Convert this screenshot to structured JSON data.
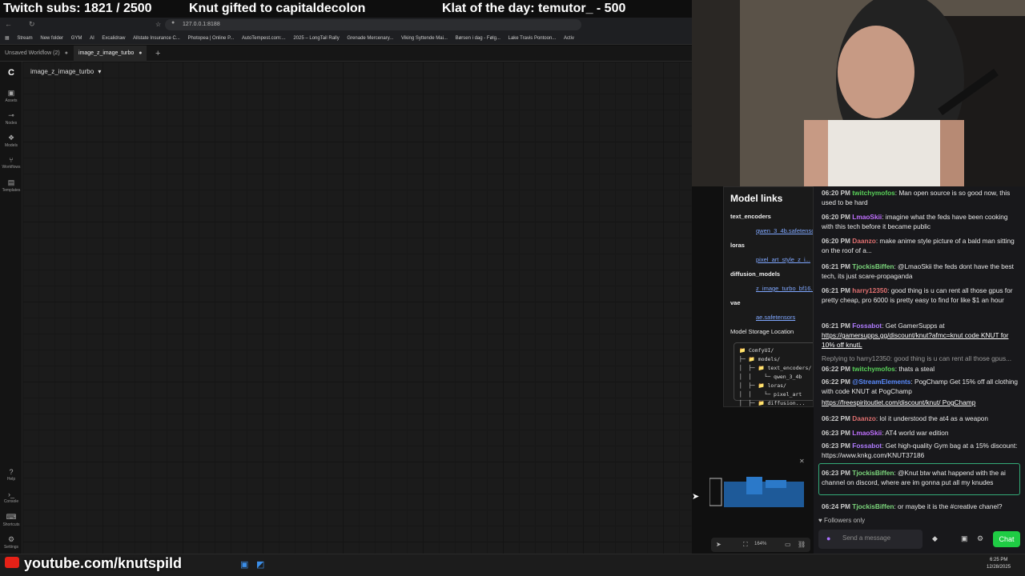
{
  "overlay": {
    "subs": "Twitch subs: 1821 / 2500",
    "gift": "Knut gifted to capitaldecolon",
    "klat": "Klat of the day: temutor_ - 500"
  },
  "browser": {
    "url": "127.0.0.1:8188",
    "bookmarks": [
      "Stream",
      "New folder",
      "GYM",
      "AI",
      "Excalidraw",
      "Allstate Insurance C...",
      "Photopea | Online P...",
      "AutoTempest.com:...",
      "2025 – LongTail Rally",
      "Grenade Mercenary...",
      "Viking Syttende Mai...",
      "Børsen i dag - Følg...",
      "Lake Travis Pontoon...",
      "Activ"
    ]
  },
  "tabs": [
    {
      "label": "Unsaved Workflow (2)"
    },
    {
      "label": "image_z_image_turbo"
    }
  ],
  "sidebar": {
    "top": [
      {
        "label": "Assets",
        "icon": "assets-icon"
      },
      {
        "label": "Nodes",
        "icon": "nodes-icon"
      },
      {
        "label": "Models",
        "icon": "models-icon"
      },
      {
        "label": "Workflows",
        "icon": "workflows-icon"
      },
      {
        "label": "Templates",
        "icon": "templates-icon"
      }
    ],
    "bottom": [
      {
        "label": "Help",
        "icon": "help-icon"
      },
      {
        "label": "Console",
        "icon": "console-icon"
      },
      {
        "label": "Shortcuts",
        "icon": "shortcuts-icon"
      },
      {
        "label": "Settings",
        "icon": "settings-icon"
      }
    ]
  },
  "workflow": {
    "name": "image_z_image_turbo"
  },
  "model_links": {
    "title": "Model links",
    "sections": [
      {
        "name": "text_encoders",
        "link": "qwen_3_4b.safetensors"
      },
      {
        "name": "loras",
        "link": "pixel_art_style_z_i..."
      },
      {
        "name": "diffusion_models",
        "link": "z_image_turbo_bf16..."
      },
      {
        "name": "vae",
        "link": "ae.safetensors"
      }
    ],
    "storage_title": "Model Storage Location",
    "tree": "📁 ComfyUI/\n├─ 📁 models/\n│  ├─ 📁 text_encoders/\n│  │    └─ qwen_3_4b\n│  ├─ 📁 loras/\n│  │    └─ pixel_art\n│  ├─ 📁 diffusion..."
  },
  "chat": {
    "messages": [
      {
        "time": "06:20 PM",
        "user": "twitchymofos",
        "color": "#5ad35a",
        "text": ": Man open source is so good now, this used to be hard"
      },
      {
        "time": "06:20 PM",
        "user": "LmaoSkii",
        "color": "#c070ff",
        "text": ": imagine what the feds have been cooking with this tech before it became public"
      },
      {
        "time": "06:20 PM",
        "user": "Daanzo",
        "color": "#e07070",
        "text": ": make anime style picture of a bald man sitting on the roof of a..."
      },
      {
        "time": "06:21 PM",
        "user": "TjockisBiffen",
        "color": "#7dd87d",
        "text": ": @LmaoSkii the feds dont have the best tech, its just scare-propaganda"
      },
      {
        "time": "06:21 PM",
        "user": "harry12350",
        "color": "#e07070",
        "text": ": good thing is u can rent all those gpus for pretty cheap, pro 6000 is pretty easy to find for like $1 an hour"
      },
      {
        "time": "06:21 PM",
        "user": "Fossabot",
        "color": "#b07cff",
        "text": ": Get GamerSupps at"
      },
      {
        "time": "",
        "user": "",
        "color": "#fff",
        "text": "https://gamersupps.gg/discount/knut?afmc=knut code KNUT for 10% off knutL"
      },
      {
        "time": "",
        "user": "",
        "color": "#999",
        "text": "Replying to harry12350: good thing is u can rent all those gpus..."
      },
      {
        "time": "06:22 PM",
        "user": "twitchymofos",
        "color": "#5ad35a",
        "text": ": thats a steal"
      },
      {
        "time": "06:22 PM",
        "user": "@StreamElements",
        "color": "#5a8cff",
        "text": ": PogChamp Get 15% off all clothing with code KNUT at PogChamp"
      },
      {
        "time": "",
        "user": "",
        "color": "#fff",
        "text": "https://freespiritoutlet.com/discount/knut/ PogChamp"
      },
      {
        "time": "06:22 PM",
        "user": "Daanzo",
        "color": "#e07070",
        "text": ": lol it understood the at4 as a weapon"
      },
      {
        "time": "06:23 PM",
        "user": "LmaoSkii",
        "color": "#c070ff",
        "text": ": AT4 world war edition"
      },
      {
        "time": "06:23 PM",
        "user": "Fossabot",
        "color": "#b07cff",
        "text": ": Get high-quality Gym bag at a 15% discount: https://www.knkg.com/KNUT37186"
      },
      {
        "time": "06:23 PM",
        "user": "TjockisBiffen",
        "color": "#7dd87d",
        "text": ": @Knut btw what happend with the ai channel on discord, where are im gonna put all my knudes"
      },
      {
        "time": "06:24 PM",
        "user": "TjockisBiffen",
        "color": "#7dd87d",
        "text": ": or maybe it is the #creative chanel?"
      }
    ],
    "followers_only": "Followers only",
    "input_placeholder": "Send a message",
    "chat_button": "Chat"
  },
  "canvas_controls": {
    "zoom": "164%"
  },
  "taskbar": {
    "time": "6:25 PM",
    "date": "12/28/2025"
  },
  "watermark": "youtube.com/knutspild"
}
